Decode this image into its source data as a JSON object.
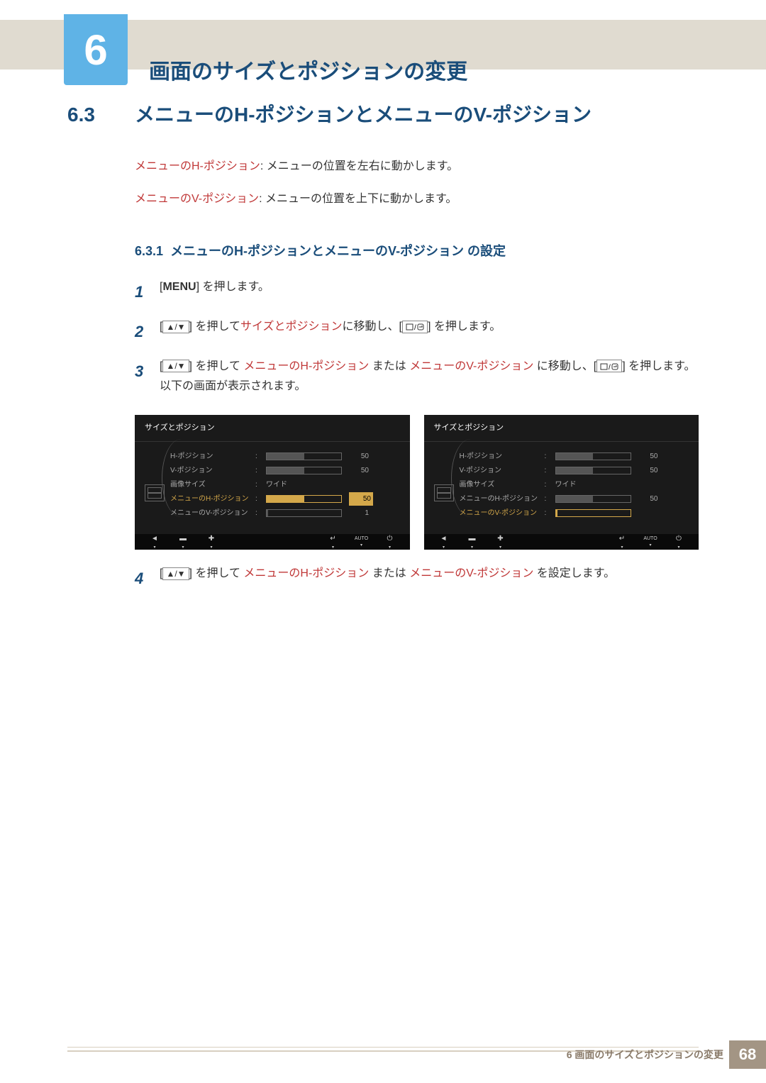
{
  "chapter": {
    "number": "6",
    "title": "画面のサイズとポジションの変更"
  },
  "section": {
    "number": "6.3",
    "title": "メニューのH-ポジションとメニューのV-ポジション"
  },
  "descriptions": {
    "h_label": "メニューのH-ポジション",
    "h_text": ": メニューの位置を左右に動かします。",
    "v_label": "メニューのV-ポジション",
    "v_text": ": メニューの位置を上下に動かします。"
  },
  "subsection": {
    "number": "6.3.1",
    "title": "メニューのH-ポジションとメニューのV-ポジション の設定"
  },
  "steps": {
    "s1": {
      "num": "1",
      "pre": "[",
      "key": "MENU",
      "post": "] を押します。"
    },
    "s2": {
      "num": "2",
      "t1": "[",
      "t2": "] を押して",
      "t3": "サイズとポジション",
      "t4": "に移動し、[",
      "t5": "] を押します。"
    },
    "s3": {
      "num": "3",
      "t1": "[",
      "t2": "] を押して ",
      "t3": "メニューのH-ポジション",
      "t4": " または ",
      "t5": "メニューのV-ポジション",
      "t6": " に移動し、[",
      "t7": "] を押します。以下の画面が表示されます。"
    },
    "s4": {
      "num": "4",
      "t1": "[",
      "t2": "] を押して ",
      "t3": "メニューのH-ポジション",
      "t4": " または ",
      "t5": "メニューのV-ポジション",
      "t6": " を設定します。"
    }
  },
  "osd": {
    "title": "サイズとポジション",
    "rows": {
      "hpos": {
        "label": "H-ポジション",
        "val": "50"
      },
      "vpos": {
        "label": "V-ポジション",
        "val": "50"
      },
      "size": {
        "label": "画像サイズ",
        "val": "ワイド"
      },
      "mhpos": {
        "label": "メニューのH-ポジション",
        "val": "50"
      },
      "mvpos": {
        "label": "メニューのV-ポジション",
        "val": "1"
      }
    },
    "auto": "AUTO"
  },
  "footer": {
    "text": "6 画面のサイズとポジションの変更",
    "page": "68"
  }
}
